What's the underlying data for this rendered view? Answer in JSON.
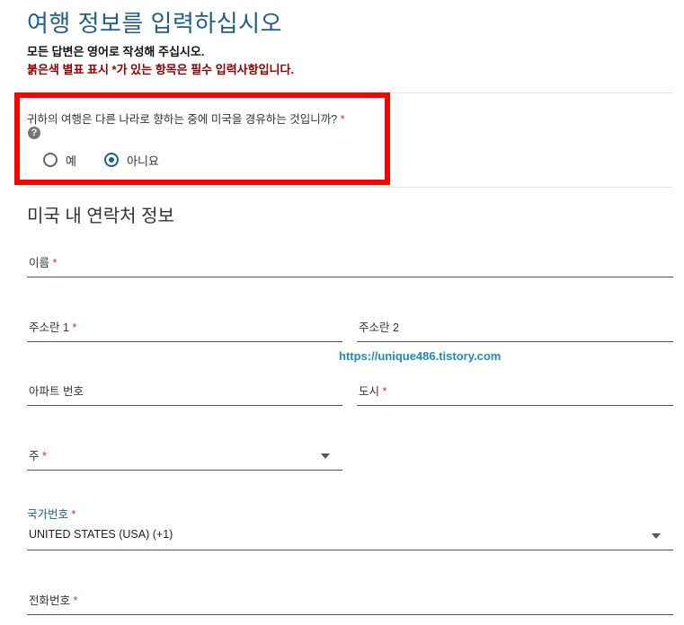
{
  "header": {
    "title": "여행 정보를 입력하십시오",
    "subtitle": "모든 답변은 영어로 작성해 주십시오.",
    "required_note": "붉은색 별표 표시 *가 있는 항목은 필수 입력사항입니다."
  },
  "transit_question": {
    "label": "귀하의 여행은 다른 나라로 향하는 중에 미국을 경유하는 것입니까?",
    "required_mark": "*",
    "help_icon": "question-circle-icon",
    "options": [
      {
        "label": "예",
        "selected": false
      },
      {
        "label": "아니요",
        "selected": true
      }
    ]
  },
  "contact_section": {
    "title": "미국 내 연락처 정보",
    "fields": {
      "name": {
        "label": "이름",
        "required": "*",
        "value": ""
      },
      "address1": {
        "label": "주소란 1",
        "required": "*",
        "value": ""
      },
      "address2": {
        "label": "주소란 2",
        "value": ""
      },
      "apartment": {
        "label": "아파트 번호",
        "value": ""
      },
      "city": {
        "label": "도시",
        "required": "*",
        "value": ""
      },
      "state": {
        "label": "주",
        "required": "*",
        "value": ""
      },
      "country_code": {
        "label": "국가번호",
        "required": "*",
        "value": "UNITED STATES (USA) (+1)"
      },
      "phone": {
        "label": "전화번호",
        "required": "*",
        "value": ""
      }
    }
  },
  "watermark": "https://unique486.tistory.com",
  "colors": {
    "accent": "#1f5f8b",
    "required": "#c0392b",
    "highlight_box": "#ff0000",
    "watermark": "#1e8bc3"
  }
}
